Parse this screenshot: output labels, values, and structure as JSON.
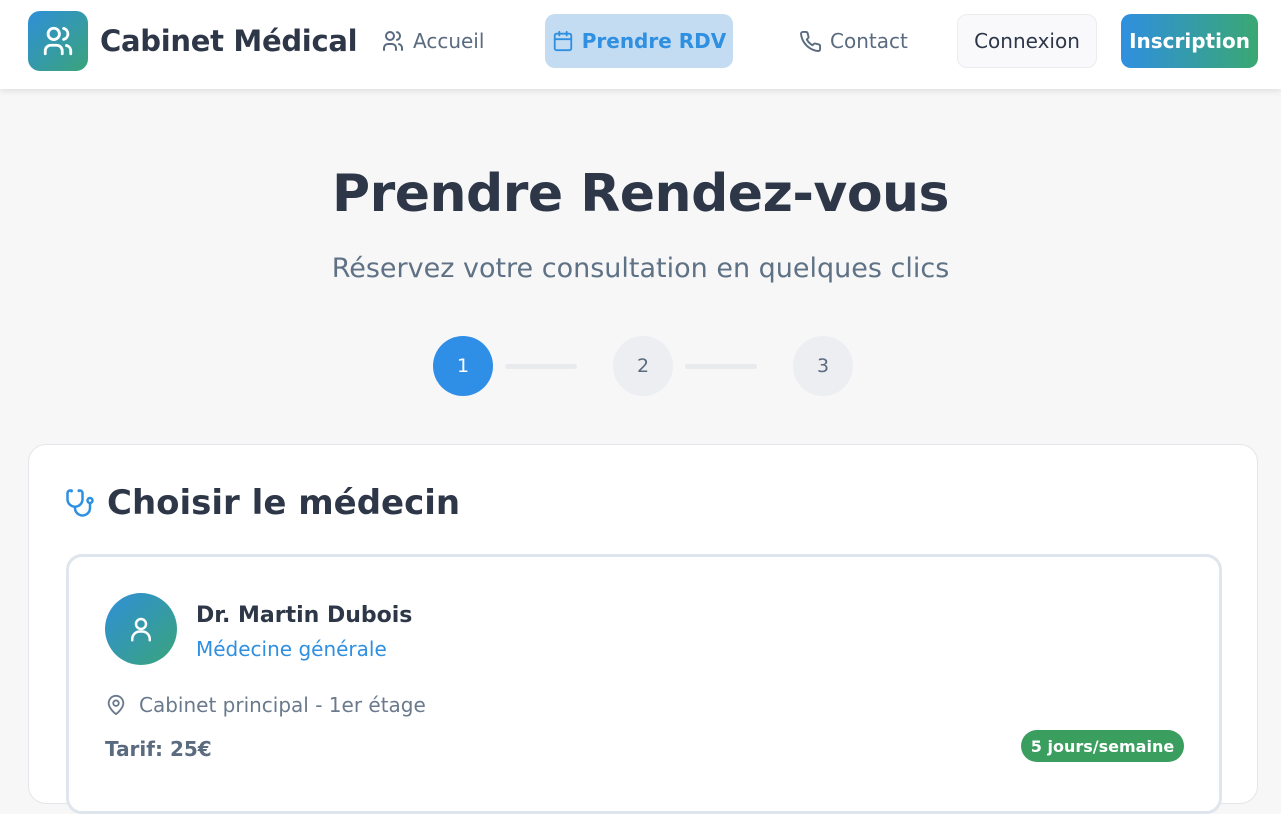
{
  "header": {
    "brand": "Cabinet Médical",
    "logo_icon": "users-icon",
    "nav": [
      {
        "label": "Accueil",
        "icon": "users-icon",
        "active": false
      },
      {
        "label": "Prendre RDV",
        "icon": "calendar-icon",
        "active": true
      },
      {
        "label": "Contact",
        "icon": "phone-icon",
        "active": false
      }
    ],
    "login_label": "Connexion",
    "signup_label": "Inscription"
  },
  "hero": {
    "title": "Prendre Rendez-vous",
    "subtitle": "Réservez votre consultation en quelques clics"
  },
  "stepper": {
    "steps": [
      "1",
      "2",
      "3"
    ],
    "current": 1
  },
  "doctor_section": {
    "title": "Choisir le médecin",
    "icon": "stethoscope-icon",
    "doctors": [
      {
        "name": "Dr. Martin Dubois",
        "specialty": "Médecine générale",
        "location": "Cabinet principal - 1er étage",
        "tarif": "Tarif: 25€",
        "availability": "5 jours/semaine"
      }
    ]
  },
  "colors": {
    "primary_blue": "#2f8fe0",
    "accent_green": "#3aa47a",
    "badge_green": "#3a9e5e",
    "active_nav_bg": "#c3dcf2",
    "text_dark": "#2d3748",
    "text_muted": "#5f7285"
  }
}
